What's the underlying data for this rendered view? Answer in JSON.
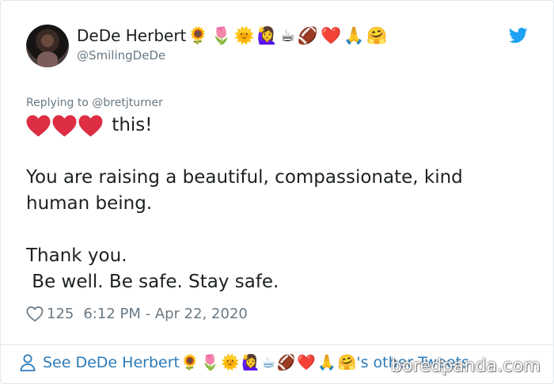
{
  "tweet": {
    "author": {
      "display_name": "DeDe Herbert",
      "name_emojis": [
        "🌻",
        "🌷",
        "🌞",
        "🙋‍♀️",
        "☕",
        "🏈",
        "❤️",
        "🙏",
        "🤗"
      ],
      "handle": "@SmilingDeDe"
    },
    "reply_to": "Replying to @bretjturner",
    "text": {
      "hearts": [
        "heart-icon",
        "heart-icon",
        "heart-icon"
      ],
      "hearts_color": "#dd2e44",
      "line1_suffix": " this!",
      "line2": "You are raising a beautiful, compassionate, kind",
      "line3": "human being.",
      "line4": "Thank you.",
      "line5": " Be well. Be safe. Stay safe."
    },
    "likes": "125",
    "timestamp": "6:12 PM - Apr 22, 2020"
  },
  "footer": {
    "prefix": "See DeDe Herbert",
    "suffix": "'s other Tweets"
  },
  "watermark": "boredpanda.com",
  "colors": {
    "twitter_blue": "#1da1f2",
    "link_blue": "#2b7bb9",
    "secondary_text": "#697882",
    "border": "#e1e8ed"
  }
}
